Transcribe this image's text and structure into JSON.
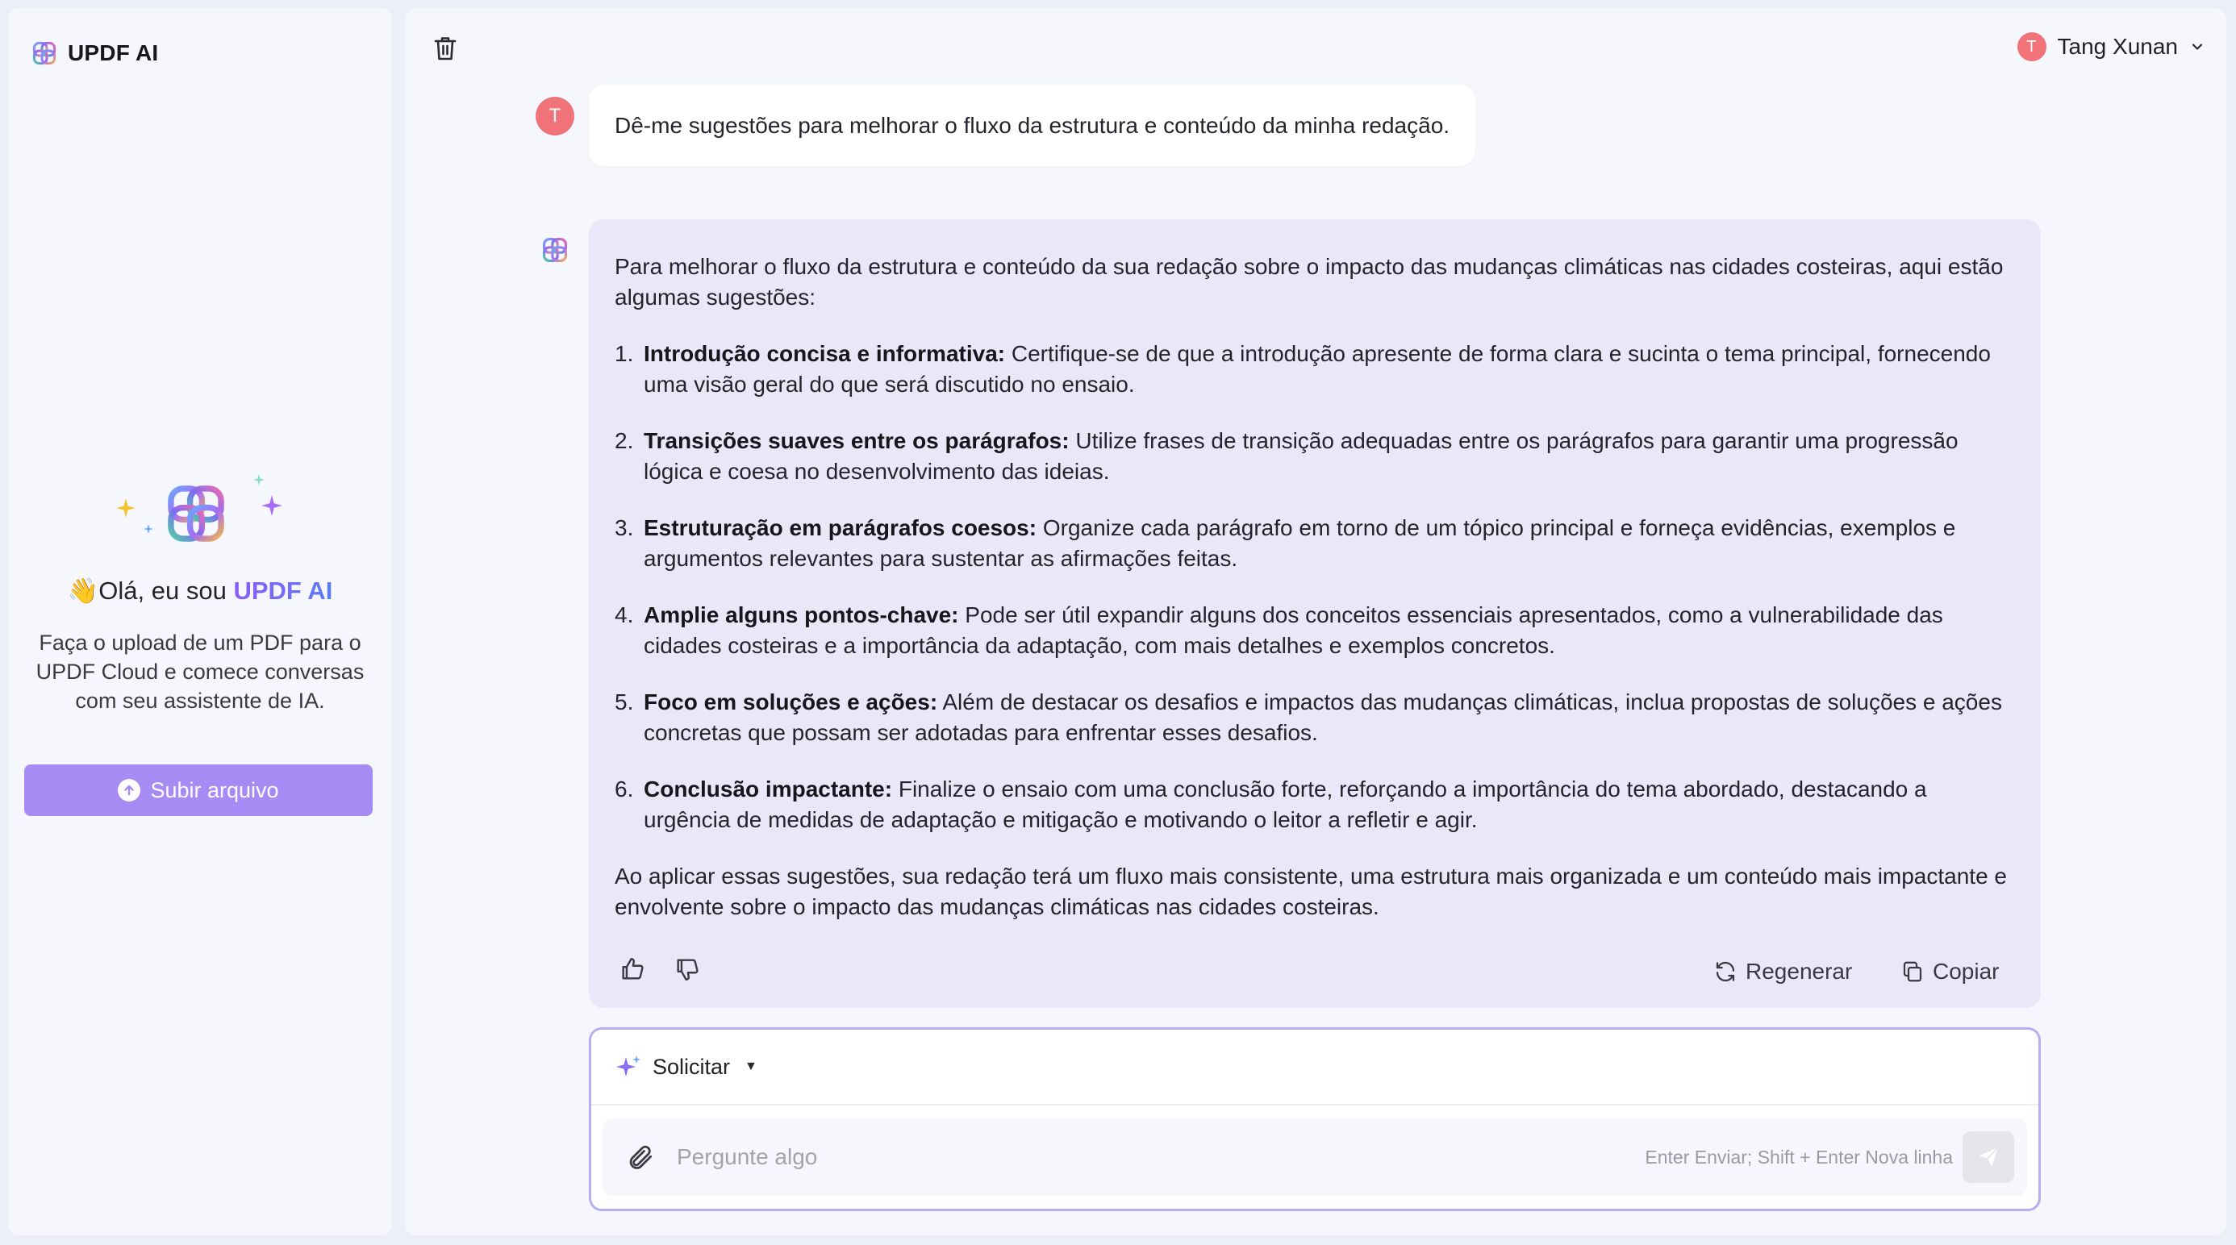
{
  "sidebar": {
    "brand": "UPDF AI",
    "greeting_emoji": "👋",
    "greeting_prefix": "Olá, eu sou ",
    "greeting_accent": "UPDF AI",
    "description": "Faça o upload de um PDF para o UPDF Cloud e comece conversas com seu assistente de IA.",
    "upload_label": "Subir arquivo"
  },
  "header": {
    "avatar_initial": "T",
    "user_name": "Tang Xunan"
  },
  "chat": {
    "user_initial": "T",
    "user_message": "Dê-me sugestões para melhorar o fluxo da estrutura e conteúdo da minha redação.",
    "ai_intro": "Para melhorar o fluxo da estrutura e conteúdo da sua redação sobre o impacto das mudanças climáticas nas cidades costeiras, aqui estão algumas sugestões:",
    "ai_items": [
      {
        "num": "1.",
        "title": "Introdução concisa e informativa:",
        "text": " Certifique-se de que a introdução apresente de forma clara e sucinta o tema principal, fornecendo uma visão geral do que será discutido no ensaio."
      },
      {
        "num": "2.",
        "title": "Transições suaves entre os parágrafos:",
        "text": " Utilize frases de transição adequadas entre os parágrafos para garantir uma progressão lógica e coesa no desenvolvimento das ideias."
      },
      {
        "num": "3.",
        "title": "Estruturação em parágrafos coesos:",
        "text": " Organize cada parágrafo em torno de um tópico principal e forneça evidências, exemplos e argumentos relevantes para sustentar as afirmações feitas."
      },
      {
        "num": "4.",
        "title": "Amplie alguns pontos-chave:",
        "text": " Pode ser útil expandir alguns dos conceitos essenciais apresentados, como a vulnerabilidade das cidades costeiras e a importância da adaptação, com mais detalhes e exemplos concretos."
      },
      {
        "num": "5.",
        "title": "Foco em soluções e ações:",
        "text": " Além de destacar os desafios e impactos das mudanças climáticas, inclua propostas de soluções e ações concretas que possam ser adotadas para enfrentar esses desafios."
      },
      {
        "num": "6.",
        "title": "Conclusão impactante:",
        "text": " Finalize o ensaio com uma conclusão forte, reforçando a importância do tema abordado, destacando a urgência de medidas de adaptação e mitigação e motivando o leitor a refletir e agir."
      }
    ],
    "ai_outro": "Ao aplicar essas sugestões, sua redação terá um fluxo mais consistente, uma estrutura mais organizada e um conteúdo mais impactante e envolvente sobre o impacto das mudanças climáticas nas cidades costeiras.",
    "regenerate_label": "Regenerar",
    "copy_label": "Copiar"
  },
  "composer": {
    "prompt_label": "Solicitar",
    "placeholder": "Pergunte algo",
    "hint": "Enter Enviar; Shift + Enter Nova linha"
  },
  "colors": {
    "accent": "#a68bf5",
    "ai_bubble": "#e9e8f9",
    "avatar": "#f0737a",
    "composer_border": "#b6aef3"
  },
  "icons": [
    "updf-logo-icon",
    "trash-icon",
    "chevron-down-icon",
    "sparkle-icon",
    "upload-icon",
    "thumbs-up-icon",
    "thumbs-down-icon",
    "refresh-icon",
    "copy-icon",
    "paperclip-icon",
    "send-icon"
  ]
}
